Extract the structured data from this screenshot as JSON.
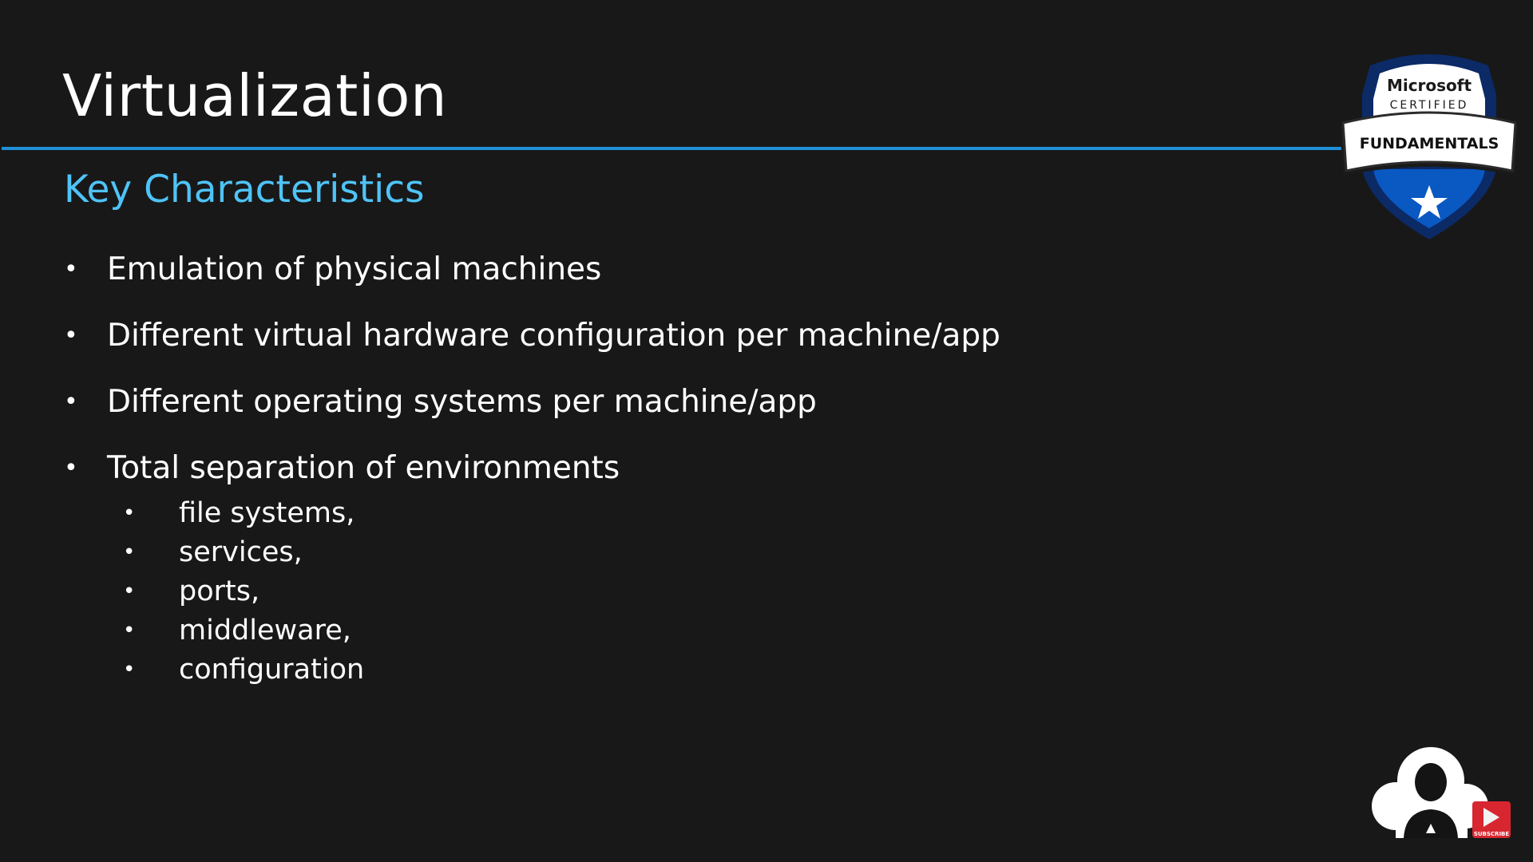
{
  "slide": {
    "title": "Virtualization",
    "subtitle": "Key Characteristics",
    "bullets": [
      "Emulation of physical machines",
      "Different virtual hardware configuration per machine/app",
      "Different operating systems per machine/app",
      "Total separation of  environments"
    ],
    "sub_bullets": [
      "file systems,",
      "services,",
      "ports,",
      "middleware,",
      "configuration"
    ],
    "bullet_glyph": "•"
  },
  "badge": {
    "brand": "Microsoft",
    "certified": "CERTIFIED",
    "level": "FUNDAMENTALS",
    "icon": "star-icon",
    "colors": {
      "navy": "#0b2a66",
      "blue": "#0a58c2",
      "white": "#ffffff"
    }
  },
  "channel": {
    "logo_icon": "cloud-avatar-icon",
    "subscribe_label": "SUBSCRIBE",
    "subscribe_icon": "play-icon",
    "subscribe_color": "#d7262f"
  },
  "theme": {
    "background": "#181818",
    "accent": "#1e90d8",
    "subtitle_color": "#4fc3f7"
  }
}
